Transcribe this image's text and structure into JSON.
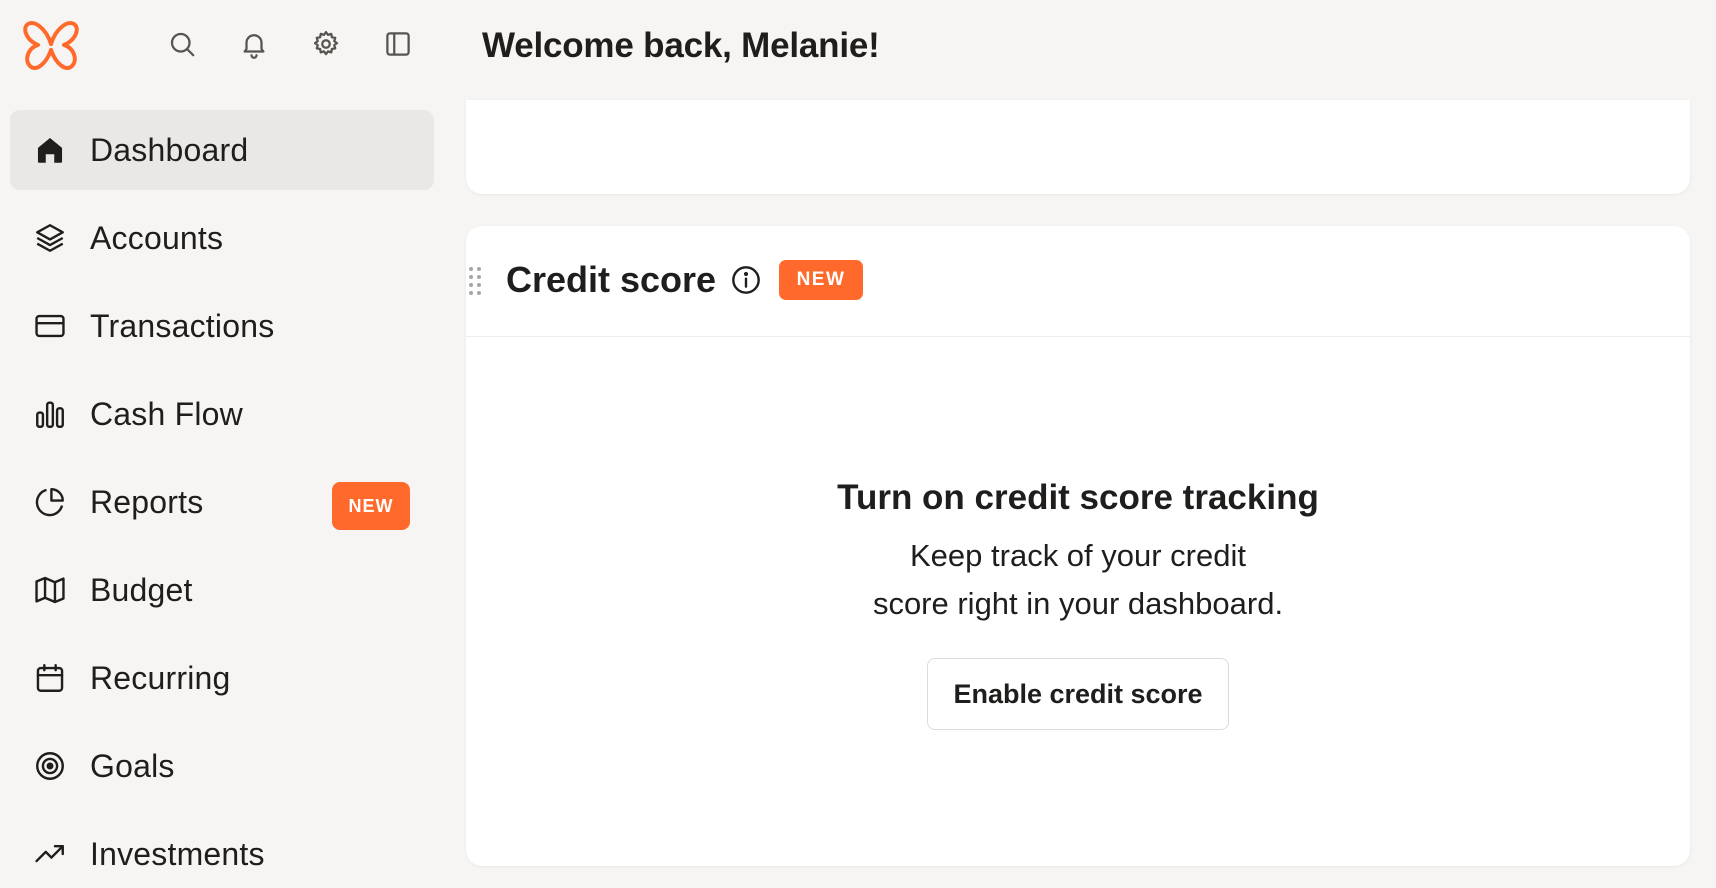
{
  "header": {
    "welcome": "Welcome back, Melanie!",
    "icons": [
      "search-icon",
      "bell-icon",
      "gear-icon",
      "sidebar-toggle-icon"
    ]
  },
  "sidebar": {
    "items": [
      {
        "label": "Dashboard",
        "icon": "home-icon",
        "active": true
      },
      {
        "label": "Accounts",
        "icon": "layers-icon"
      },
      {
        "label": "Transactions",
        "icon": "credit-card-icon"
      },
      {
        "label": "Cash Flow",
        "icon": "bar-chart-icon"
      },
      {
        "label": "Reports",
        "icon": "pie-chart-icon",
        "badge": "NEW"
      },
      {
        "label": "Budget",
        "icon": "map-icon"
      },
      {
        "label": "Recurring",
        "icon": "calendar-icon"
      },
      {
        "label": "Goals",
        "icon": "target-icon"
      },
      {
        "label": "Investments",
        "icon": "trending-up-icon"
      }
    ]
  },
  "credit_card": {
    "title": "Credit score",
    "badge": "NEW",
    "cta_title": "Turn on credit score tracking",
    "cta_line1": "Keep track of your credit",
    "cta_line2": "score right in your dashboard.",
    "button_label": "Enable credit score"
  },
  "colors": {
    "accent": "#ff6a2c",
    "background": "#f6f5f3",
    "card": "#ffffff",
    "active_nav": "#e9e8e6",
    "text": "#1f1e1d"
  }
}
